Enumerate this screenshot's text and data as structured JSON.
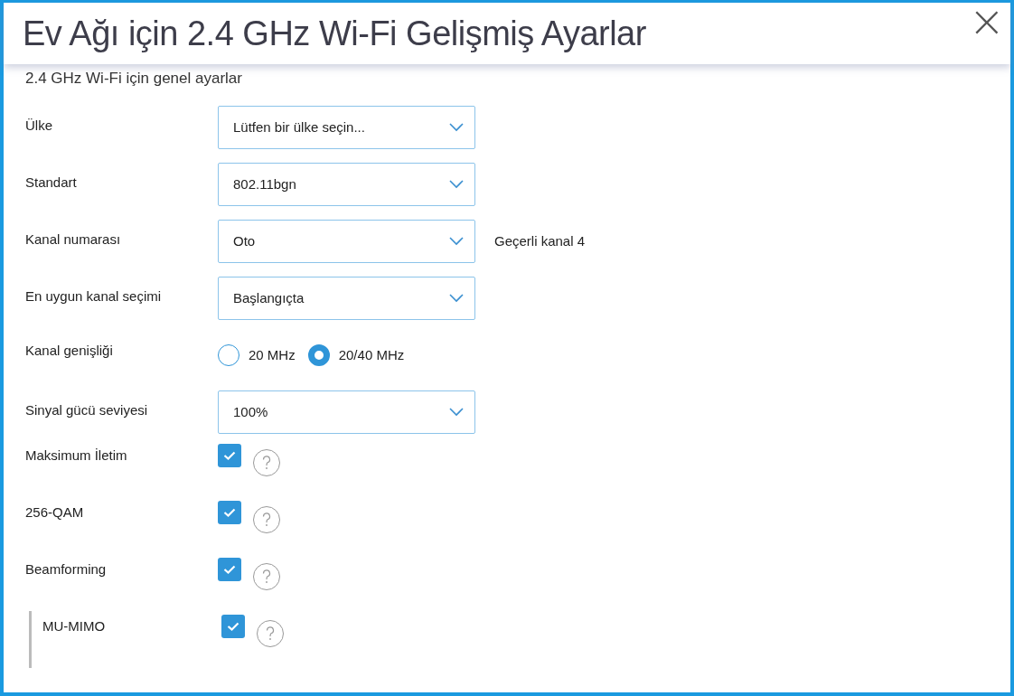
{
  "window": {
    "title": "Ev Ağı için 2.4 GHz Wi-Fi Gelişmiş Ayarlar",
    "close": "×"
  },
  "section_title": "2.4 GHz Wi-Fi için genel ayarlar",
  "settings": [
    {
      "kind": "select",
      "label": "Ülke",
      "value": "Lütfen bir ülke seçin..."
    },
    {
      "kind": "select",
      "label": "Standart",
      "value": "802.11bgn"
    },
    {
      "kind": "select",
      "label": "Kanal numarası",
      "value": "Oto",
      "note": "Geçerli kanal 4"
    },
    {
      "kind": "select",
      "label": "En uygun kanal seçimi",
      "value": "Başlangıçta"
    },
    {
      "kind": "radio",
      "label": "Kanal genişliği",
      "options": [
        {
          "label": "20 MHz",
          "selected": false
        },
        {
          "label": "20/40 MHz",
          "selected": true
        }
      ]
    },
    {
      "kind": "select",
      "label": "Sinyal gücü seviyesi",
      "value": "100%"
    },
    {
      "kind": "checkbox",
      "label": "Maksimum İletim",
      "checked": true
    },
    {
      "kind": "checkbox",
      "label": "256-QAM",
      "checked": true
    },
    {
      "kind": "checkbox",
      "label": "Beamforming",
      "checked": true,
      "children": [
        {
          "kind": "checkbox",
          "label": "MU-MIMO",
          "checked": true
        }
      ]
    }
  ]
}
